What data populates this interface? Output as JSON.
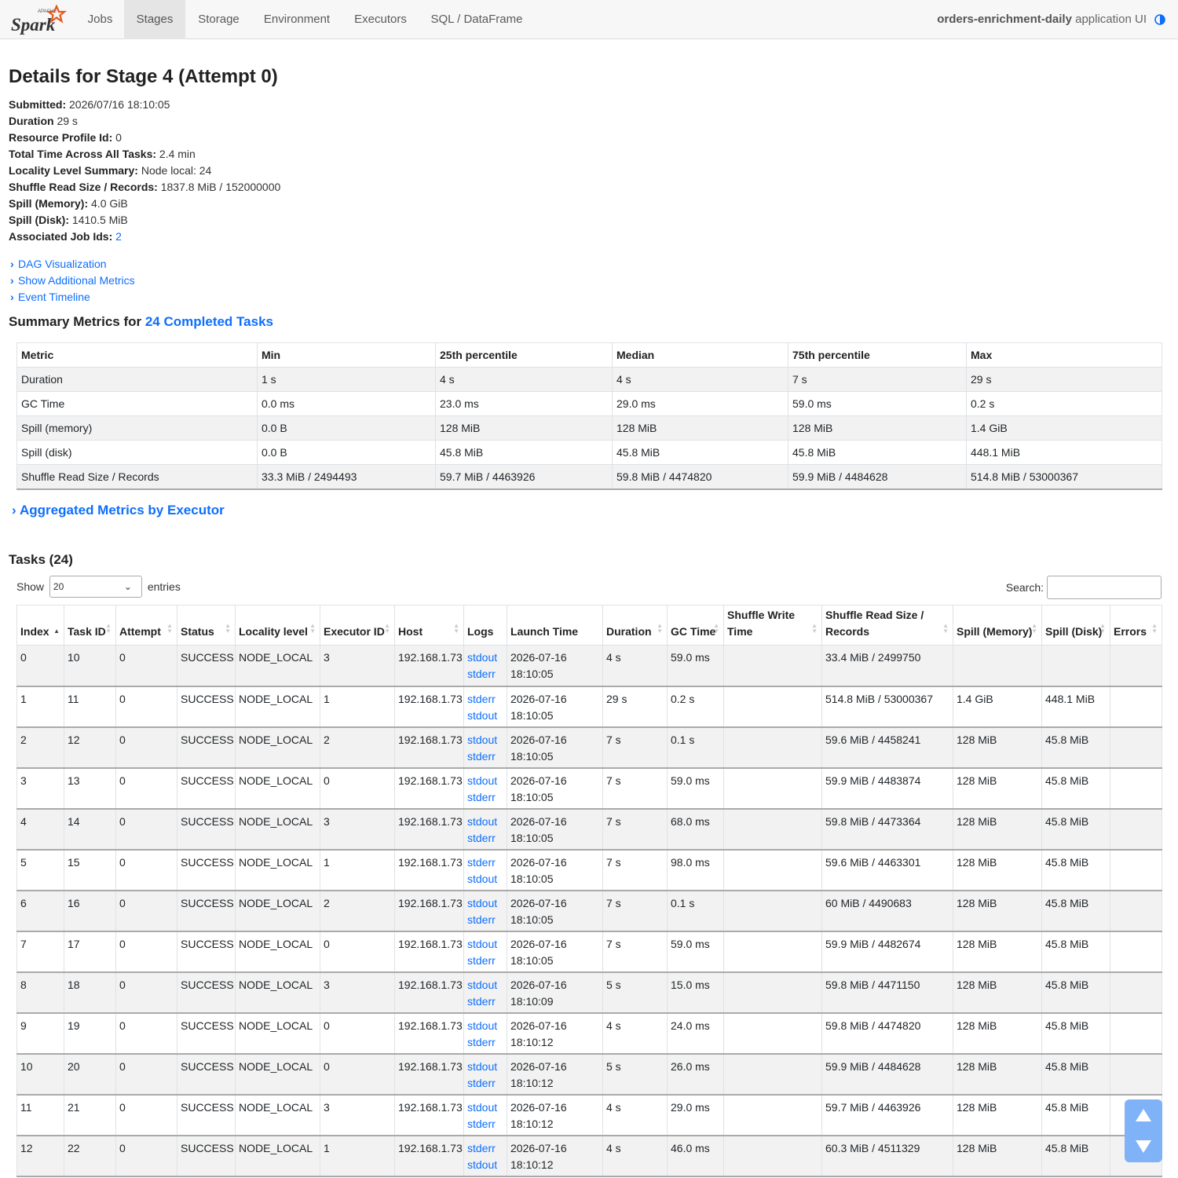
{
  "navbar": {
    "brand_small": "APACHE",
    "brand": "Spark",
    "tabs": [
      {
        "label": "Jobs",
        "active": false
      },
      {
        "label": "Stages",
        "active": true
      },
      {
        "label": "Storage",
        "active": false
      },
      {
        "label": "Environment",
        "active": false
      },
      {
        "label": "Executors",
        "active": false
      },
      {
        "label": "SQL / DataFrame",
        "active": false
      }
    ],
    "app_name": "orders-enrichment-daily",
    "app_suffix": " application UI"
  },
  "page": {
    "title": "Details for Stage 4 (Attempt 0)",
    "summary": [
      {
        "label": "Submitted:",
        "value": " 2026/07/16 18:10:05"
      },
      {
        "label": "Duration",
        "value": " 29 s"
      },
      {
        "label": "Resource Profile Id:",
        "value": " 0"
      },
      {
        "label": "Total Time Across All Tasks:",
        "value": " 2.4 min"
      },
      {
        "label": "Locality Level Summary:",
        "value": " Node local: 24"
      },
      {
        "label": "Shuffle Read Size / Records:",
        "value": " 1837.8 MiB / 152000000"
      },
      {
        "label": "Spill (Memory):",
        "value": " 4.0 GiB"
      },
      {
        "label": "Spill (Disk):",
        "value": " 1410.5 MiB"
      }
    ],
    "job_ids_label": "Associated Job Ids:",
    "job_ids_link": "2",
    "toggles": [
      "DAG Visualization",
      "Show Additional Metrics",
      "Event Timeline"
    ]
  },
  "summary_metrics": {
    "heading_prefix": "Summary Metrics for ",
    "heading_link": "24 Completed Tasks",
    "columns": [
      "Metric",
      "Min",
      "25th percentile",
      "Median",
      "75th percentile",
      "Max"
    ],
    "rows": [
      [
        "Duration",
        "1 s",
        "4 s",
        "4 s",
        "7 s",
        "29 s"
      ],
      [
        "GC Time",
        "0.0 ms",
        "23.0 ms",
        "29.0 ms",
        "59.0 ms",
        "0.2 s"
      ],
      [
        "Spill (memory)",
        "0.0 B",
        "128 MiB",
        "128 MiB",
        "128 MiB",
        "1.4 GiB"
      ],
      [
        "Spill (disk)",
        "0.0 B",
        "45.8 MiB",
        "45.8 MiB",
        "45.8 MiB",
        "448.1 MiB"
      ],
      [
        "Shuffle Read Size / Records",
        "33.3 MiB / 2494493",
        "59.7 MiB / 4463926",
        "59.8 MiB / 4474820",
        "59.9 MiB / 4484628",
        "514.8 MiB / 53000367"
      ]
    ]
  },
  "aggregated_label": "Aggregated Metrics by Executor",
  "tasks": {
    "heading": "Tasks (24)",
    "show_label": "Show",
    "page_size": "20",
    "entries_label": "entries",
    "search_label": "Search:",
    "search_value": "",
    "columns": [
      "Index",
      "Task ID",
      "Attempt",
      "Status",
      "Locality level",
      "Executor ID",
      "Host",
      "Logs",
      "Launch Time",
      "Duration",
      "GC Time",
      "Shuffle Write Time",
      "Shuffle Read Size / Records",
      "Spill (Memory)",
      "Spill (Disk)",
      "Errors"
    ],
    "rows": [
      {
        "index": "0",
        "task_id": "10",
        "attempt": "0",
        "status": "SUCCESS",
        "locality": "NODE_LOCAL",
        "executor": "3",
        "host": "192.168.1.73",
        "log1": "stdout",
        "log2": "stderr",
        "launch_date": "2026-07-16",
        "launch_time": "18:10:05",
        "duration": "4 s",
        "gc": "59.0 ms",
        "shuffle_write": "",
        "shuffle_read": "33.4 MiB / 2499750",
        "spill_mem": "",
        "spill_disk": "",
        "errors": ""
      },
      {
        "index": "1",
        "task_id": "11",
        "attempt": "0",
        "status": "SUCCESS",
        "locality": "NODE_LOCAL",
        "executor": "1",
        "host": "192.168.1.73",
        "log1": "stderr",
        "log2": "stdout",
        "launch_date": "2026-07-16",
        "launch_time": "18:10:05",
        "duration": "29 s",
        "gc": "0.2 s",
        "shuffle_write": "",
        "shuffle_read": "514.8 MiB / 53000367",
        "spill_mem": "1.4 GiB",
        "spill_disk": "448.1 MiB",
        "errors": ""
      },
      {
        "index": "2",
        "task_id": "12",
        "attempt": "0",
        "status": "SUCCESS",
        "locality": "NODE_LOCAL",
        "executor": "2",
        "host": "192.168.1.73",
        "log1": "stdout",
        "log2": "stderr",
        "launch_date": "2026-07-16",
        "launch_time": "18:10:05",
        "duration": "7 s",
        "gc": "0.1 s",
        "shuffle_write": "",
        "shuffle_read": "59.6 MiB / 4458241",
        "spill_mem": "128 MiB",
        "spill_disk": "45.8 MiB",
        "errors": ""
      },
      {
        "index": "3",
        "task_id": "13",
        "attempt": "0",
        "status": "SUCCESS",
        "locality": "NODE_LOCAL",
        "executor": "0",
        "host": "192.168.1.73",
        "log1": "stdout",
        "log2": "stderr",
        "launch_date": "2026-07-16",
        "launch_time": "18:10:05",
        "duration": "7 s",
        "gc": "59.0 ms",
        "shuffle_write": "",
        "shuffle_read": "59.9 MiB / 4483874",
        "spill_mem": "128 MiB",
        "spill_disk": "45.8 MiB",
        "errors": ""
      },
      {
        "index": "4",
        "task_id": "14",
        "attempt": "0",
        "status": "SUCCESS",
        "locality": "NODE_LOCAL",
        "executor": "3",
        "host": "192.168.1.73",
        "log1": "stdout",
        "log2": "stderr",
        "launch_date": "2026-07-16",
        "launch_time": "18:10:05",
        "duration": "7 s",
        "gc": "68.0 ms",
        "shuffle_write": "",
        "shuffle_read": "59.8 MiB / 4473364",
        "spill_mem": "128 MiB",
        "spill_disk": "45.8 MiB",
        "errors": ""
      },
      {
        "index": "5",
        "task_id": "15",
        "attempt": "0",
        "status": "SUCCESS",
        "locality": "NODE_LOCAL",
        "executor": "1",
        "host": "192.168.1.73",
        "log1": "stderr",
        "log2": "stdout",
        "launch_date": "2026-07-16",
        "launch_time": "18:10:05",
        "duration": "7 s",
        "gc": "98.0 ms",
        "shuffle_write": "",
        "shuffle_read": "59.6 MiB / 4463301",
        "spill_mem": "128 MiB",
        "spill_disk": "45.8 MiB",
        "errors": ""
      },
      {
        "index": "6",
        "task_id": "16",
        "attempt": "0",
        "status": "SUCCESS",
        "locality": "NODE_LOCAL",
        "executor": "2",
        "host": "192.168.1.73",
        "log1": "stdout",
        "log2": "stderr",
        "launch_date": "2026-07-16",
        "launch_time": "18:10:05",
        "duration": "7 s",
        "gc": "0.1 s",
        "shuffle_write": "",
        "shuffle_read": "60 MiB / 4490683",
        "spill_mem": "128 MiB",
        "spill_disk": "45.8 MiB",
        "errors": ""
      },
      {
        "index": "7",
        "task_id": "17",
        "attempt": "0",
        "status": "SUCCESS",
        "locality": "NODE_LOCAL",
        "executor": "0",
        "host": "192.168.1.73",
        "log1": "stdout",
        "log2": "stderr",
        "launch_date": "2026-07-16",
        "launch_time": "18:10:05",
        "duration": "7 s",
        "gc": "59.0 ms",
        "shuffle_write": "",
        "shuffle_read": "59.9 MiB / 4482674",
        "spill_mem": "128 MiB",
        "spill_disk": "45.8 MiB",
        "errors": ""
      },
      {
        "index": "8",
        "task_id": "18",
        "attempt": "0",
        "status": "SUCCESS",
        "locality": "NODE_LOCAL",
        "executor": "3",
        "host": "192.168.1.73",
        "log1": "stdout",
        "log2": "stderr",
        "launch_date": "2026-07-16",
        "launch_time": "18:10:09",
        "duration": "5 s",
        "gc": "15.0 ms",
        "shuffle_write": "",
        "shuffle_read": "59.8 MiB / 4471150",
        "spill_mem": "128 MiB",
        "spill_disk": "45.8 MiB",
        "errors": ""
      },
      {
        "index": "9",
        "task_id": "19",
        "attempt": "0",
        "status": "SUCCESS",
        "locality": "NODE_LOCAL",
        "executor": "0",
        "host": "192.168.1.73",
        "log1": "stdout",
        "log2": "stderr",
        "launch_date": "2026-07-16",
        "launch_time": "18:10:12",
        "duration": "4 s",
        "gc": "24.0 ms",
        "shuffle_write": "",
        "shuffle_read": "59.8 MiB / 4474820",
        "spill_mem": "128 MiB",
        "spill_disk": "45.8 MiB",
        "errors": ""
      },
      {
        "index": "10",
        "task_id": "20",
        "attempt": "0",
        "status": "SUCCESS",
        "locality": "NODE_LOCAL",
        "executor": "0",
        "host": "192.168.1.73",
        "log1": "stdout",
        "log2": "stderr",
        "launch_date": "2026-07-16",
        "launch_time": "18:10:12",
        "duration": "5 s",
        "gc": "26.0 ms",
        "shuffle_write": "",
        "shuffle_read": "59.9 MiB / 4484628",
        "spill_mem": "128 MiB",
        "spill_disk": "45.8 MiB",
        "errors": ""
      },
      {
        "index": "11",
        "task_id": "21",
        "attempt": "0",
        "status": "SUCCESS",
        "locality": "NODE_LOCAL",
        "executor": "3",
        "host": "192.168.1.73",
        "log1": "stdout",
        "log2": "stderr",
        "launch_date": "2026-07-16",
        "launch_time": "18:10:12",
        "duration": "4 s",
        "gc": "29.0 ms",
        "shuffle_write": "",
        "shuffle_read": "59.7 MiB / 4463926",
        "spill_mem": "128 MiB",
        "spill_disk": "45.8 MiB",
        "errors": ""
      },
      {
        "index": "12",
        "task_id": "22",
        "attempt": "0",
        "status": "SUCCESS",
        "locality": "NODE_LOCAL",
        "executor": "1",
        "host": "192.168.1.73",
        "log1": "stderr",
        "log2": "stdout",
        "launch_date": "2026-07-16",
        "launch_time": "18:10:12",
        "duration": "4 s",
        "gc": "46.0 ms",
        "shuffle_write": "",
        "shuffle_read": "60.3 MiB / 4511329",
        "spill_mem": "128 MiB",
        "spill_disk": "45.8 MiB",
        "errors": ""
      }
    ]
  }
}
